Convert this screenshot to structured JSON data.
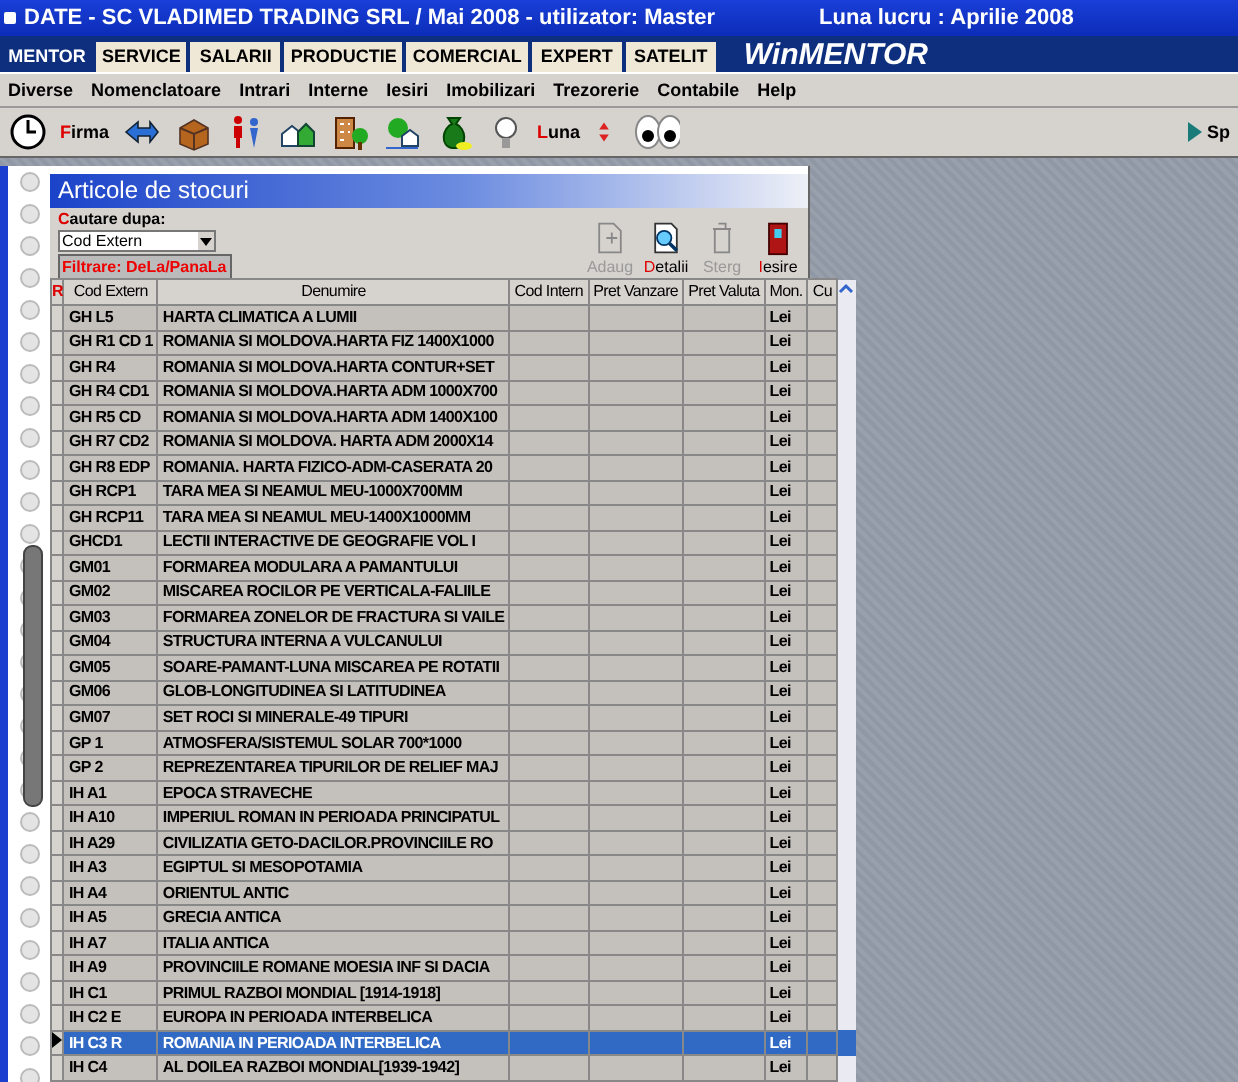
{
  "window": {
    "title": "DATE - SC VLADIMED TRADING SRL / Mai 2008 - utilizator: Master",
    "work_month": "Luna lucru : Aprilie 2008"
  },
  "modules": [
    {
      "label": "MENTOR",
      "selected": true
    },
    {
      "label": "SERVICE",
      "selected": false
    },
    {
      "label": "SALARII",
      "selected": false
    },
    {
      "label": "PRODUCTIE",
      "selected": false
    },
    {
      "label": "COMERCIAL",
      "selected": false
    },
    {
      "label": "EXPERT",
      "selected": false
    },
    {
      "label": "SATELIT",
      "selected": false
    }
  ],
  "logo": "WinMENTOR",
  "menu": [
    "Diverse",
    "Nomenclatoare",
    "Intrari",
    "Interne",
    "Iesiri",
    "Imobilizari",
    "Trezorerie",
    "Contabile",
    "Help"
  ],
  "toolbar": {
    "firm_label": "Firma",
    "month_label": "Luna",
    "right_label": "Sp"
  },
  "panel": {
    "title": "Articole de stocuri",
    "search_label": "Cautare dupa:",
    "search_value": "Cod Extern",
    "filter_label": "Filtrare: DeLa/PanaLa",
    "actions": [
      {
        "label": "Adaug",
        "disabled": true
      },
      {
        "label": "Detalii",
        "disabled": false
      },
      {
        "label": "Sterg",
        "disabled": true
      },
      {
        "label": "Iesire",
        "disabled": false
      }
    ]
  },
  "table": {
    "marker_header": "R",
    "columns": [
      "Cod Extern",
      "Denumire",
      "Cod Intern",
      "Pret Vanzare",
      "Pret Valuta",
      "Mon.",
      "Cu"
    ],
    "rows": [
      {
        "cod": "GH L5",
        "denumire": "HARTA CLIMATICA A LUMII",
        "mon": "Lei",
        "selected": false
      },
      {
        "cod": "GH R1 CD 1",
        "denumire": "ROMANIA SI MOLDOVA.HARTA FIZ 1400X1000",
        "mon": "Lei",
        "selected": false
      },
      {
        "cod": "GH R4",
        "denumire": "ROMANIA SI MOLDOVA.HARTA CONTUR+SET",
        "mon": "Lei",
        "selected": false
      },
      {
        "cod": "GH R4 CD1",
        "denumire": "ROMANIA SI MOLDOVA.HARTA ADM 1000X700",
        "mon": "Lei",
        "selected": false
      },
      {
        "cod": "GH R5 CD",
        "denumire": "ROMANIA SI MOLDOVA.HARTA ADM 1400X100",
        "mon": "Lei",
        "selected": false
      },
      {
        "cod": "GH R7 CD2",
        "denumire": "ROMANIA SI MOLDOVA. HARTA ADM 2000X14",
        "mon": "Lei",
        "selected": false
      },
      {
        "cod": "GH R8 EDP",
        "denumire": "ROMANIA. HARTA FIZICO-ADM-CASERATA 20",
        "mon": "Lei",
        "selected": false
      },
      {
        "cod": "GH RCP1",
        "denumire": "TARA MEA SI NEAMUL MEU-1000X700MM",
        "mon": "Lei",
        "selected": false
      },
      {
        "cod": "GH RCP11",
        "denumire": "TARA MEA SI NEAMUL MEU-1400X1000MM",
        "mon": "Lei",
        "selected": false
      },
      {
        "cod": "GHCD1",
        "denumire": "LECTII INTERACTIVE DE GEOGRAFIE VOL I",
        "mon": "Lei",
        "selected": false
      },
      {
        "cod": "GM01",
        "denumire": "FORMAREA MODULARA A PAMANTULUI",
        "mon": "Lei",
        "selected": false
      },
      {
        "cod": "GM02",
        "denumire": "MISCAREA ROCILOR PE VERTICALA-FALIILE",
        "mon": "Lei",
        "selected": false
      },
      {
        "cod": "GM03",
        "denumire": "FORMAREA ZONELOR DE FRACTURA SI VAILE",
        "mon": "Lei",
        "selected": false
      },
      {
        "cod": "GM04",
        "denumire": "STRUCTURA INTERNA A VULCANULUI",
        "mon": "Lei",
        "selected": false
      },
      {
        "cod": "GM05",
        "denumire": "SOARE-PAMANT-LUNA MISCAREA PE ROTATII",
        "mon": "Lei",
        "selected": false
      },
      {
        "cod": "GM06",
        "denumire": "GLOB-LONGITUDINEA SI LATITUDINEA",
        "mon": "Lei",
        "selected": false
      },
      {
        "cod": "GM07",
        "denumire": "SET ROCI SI MINERALE-49 TIPURI",
        "mon": "Lei",
        "selected": false
      },
      {
        "cod": "GP 1",
        "denumire": "ATMOSFERA/SISTEMUL SOLAR 700*1000",
        "mon": "Lei",
        "selected": false
      },
      {
        "cod": "GP 2",
        "denumire": "REPREZENTAREA TIPURILOR DE RELIEF MAJ",
        "mon": "Lei",
        "selected": false
      },
      {
        "cod": "IH A1",
        "denumire": "EPOCA STRAVECHE",
        "mon": "Lei",
        "selected": false
      },
      {
        "cod": "IH A10",
        "denumire": "IMPERIUL ROMAN IN PERIOADA PRINCIPATUL",
        "mon": "Lei",
        "selected": false
      },
      {
        "cod": "IH A29",
        "denumire": "CIVILIZATIA GETO-DACILOR.PROVINCIILE RO",
        "mon": "Lei",
        "selected": false
      },
      {
        "cod": "IH A3",
        "denumire": "EGIPTUL SI MESOPOTAMIA",
        "mon": "Lei",
        "selected": false
      },
      {
        "cod": "IH A4",
        "denumire": "ORIENTUL ANTIC",
        "mon": "Lei",
        "selected": false
      },
      {
        "cod": "IH A5",
        "denumire": "GRECIA ANTICA",
        "mon": "Lei",
        "selected": false
      },
      {
        "cod": "IH A7",
        "denumire": "ITALIA ANTICA",
        "mon": "Lei",
        "selected": false
      },
      {
        "cod": "IH A9",
        "denumire": "PROVINCIILE ROMANE MOESIA INF SI DACIA",
        "mon": "Lei",
        "selected": false
      },
      {
        "cod": "IH C1",
        "denumire": "PRIMUL RAZBOI MONDIAL [1914-1918]",
        "mon": "Lei",
        "selected": false
      },
      {
        "cod": "IH C2 E",
        "denumire": "EUROPA IN PERIOADA INTERBELICA",
        "mon": "Lei",
        "selected": false
      },
      {
        "cod": "IH C3 R",
        "denumire": "ROMANIA IN PERIOADA INTERBELICA",
        "mon": "Lei",
        "selected": true
      },
      {
        "cod": "IH C4",
        "denumire": "AL DOILEA RAZBOI MONDIAL[1939-1942]",
        "mon": "Lei",
        "selected": false
      }
    ]
  }
}
